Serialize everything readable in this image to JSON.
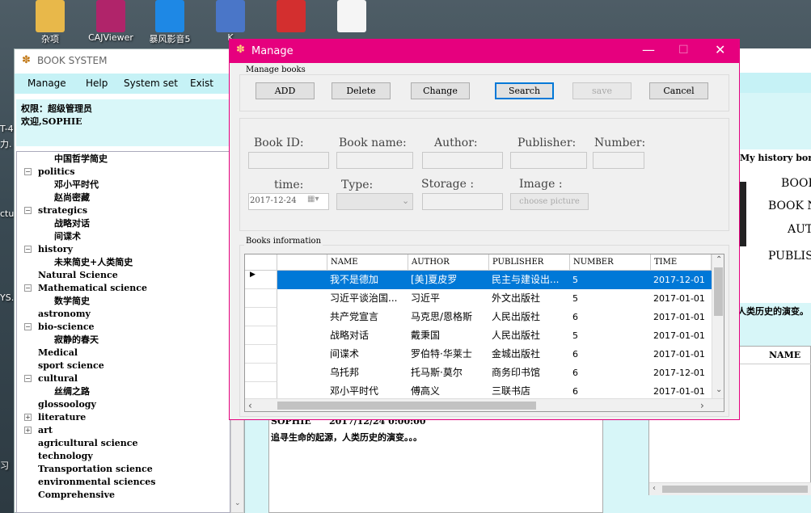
{
  "desktop": {
    "icons": [
      {
        "label": "杂项",
        "color": "#e8b84a"
      },
      {
        "label": "CAJViewer",
        "color": "#b0246a"
      },
      {
        "label": "暴风影音5",
        "color": "#1e88e5"
      },
      {
        "label": "K",
        "color": "#4a76c8"
      },
      {
        "label": "",
        "color": "#d32f2f"
      },
      {
        "label": "",
        "color": "#f5f5f5"
      }
    ],
    "side_texts": [
      "T-4",
      "力.",
      "cture",
      "YS...",
      "习"
    ]
  },
  "book_system": {
    "title": "BOOK SYSTEM",
    "menu": [
      "Manage",
      "Help",
      "System set",
      "Exist"
    ],
    "info_line1": "权限：超级管理员",
    "info_line2": "欢迎,SOPHIE",
    "tree": [
      {
        "label": "中国哲学简史",
        "level": 1
      },
      {
        "label": "politics",
        "level": 0,
        "toggle": "−"
      },
      {
        "label": "邓小平时代",
        "level": 1
      },
      {
        "label": "赵尚密藏",
        "level": 1
      },
      {
        "label": "strategics",
        "level": 0,
        "toggle": "−"
      },
      {
        "label": "战略对话",
        "level": 1
      },
      {
        "label": "间谍术",
        "level": 1
      },
      {
        "label": "history",
        "level": 0,
        "toggle": "−"
      },
      {
        "label": "未来简史+人类简史",
        "level": 1
      },
      {
        "label": "Natural Science",
        "level": 0
      },
      {
        "label": "Mathematical science",
        "level": 0,
        "toggle": "−"
      },
      {
        "label": "数学简史",
        "level": 1
      },
      {
        "label": "astronomy",
        "level": 0
      },
      {
        "label": "bio-science",
        "level": 0,
        "toggle": "−"
      },
      {
        "label": "寂静的春天",
        "level": 1
      },
      {
        "label": "Medical",
        "level": 0
      },
      {
        "label": "sport science",
        "level": 0
      },
      {
        "label": "cultural",
        "level": 0,
        "toggle": "−"
      },
      {
        "label": "丝绸之路",
        "level": 1
      },
      {
        "label": "glossoology",
        "level": 0
      },
      {
        "label": "literature",
        "level": 0,
        "toggle": "+"
      },
      {
        "label": "art",
        "level": 0,
        "toggle": "+"
      },
      {
        "label": "agricultural science",
        "level": 0
      },
      {
        "label": "technology",
        "level": 0
      },
      {
        "label": "Transportation science",
        "level": 0
      },
      {
        "label": "environmental sciences",
        "level": 0
      },
      {
        "label": "Comprehensive",
        "level": 0
      }
    ]
  },
  "background": {
    "history_title": "My history borr",
    "book_label": "BOOK",
    "book_name_label": "BOOK NA",
    "author_label": "AUTH",
    "publisher_label": "PUBLISH",
    "desc_snippet": "人类历史的演变。",
    "name_col": "NAME",
    "record_user": "SOPHIE",
    "record_time": "2017/12/24 0:00:00",
    "record_text": "追寻生命的起源，人类历史的演变。。。"
  },
  "dialog": {
    "title": "Manage",
    "controls": {
      "minimize": "—",
      "maximize": "☐",
      "close": "✕"
    },
    "manage_group": "Manage books",
    "buttons": {
      "add": "ADD",
      "delete": "Delete",
      "change": "Change",
      "search": "Search",
      "save": "save",
      "cancel": "Cancel"
    },
    "fields": {
      "book_id": "Book ID:",
      "book_name": "Book name:",
      "author": "Author:",
      "publisher": "Publisher:",
      "number": "Number:",
      "time": "time:",
      "type": "Type:",
      "storage": "Storage :",
      "image": "Image :"
    },
    "time_value": "2017-12-24",
    "choose_picture": "choose picture",
    "books_group": "Books information",
    "table": {
      "columns": [
        "NAME",
        "AUTHOR",
        "PUBLISHER",
        "NUMBER",
        "TIME"
      ],
      "rows": [
        [
          "我不是德加",
          "[美]夏皮罗",
          "民主与建设出...",
          "5",
          "2017-12-01"
        ],
        [
          "习近平谈治国...",
          "习近平",
          "外文出版社",
          "5",
          "2017-01-01"
        ],
        [
          "共产党宣言",
          "马克思/恩格斯",
          "人民出版社",
          "6",
          "2017-01-01"
        ],
        [
          "战略对话",
          "戴秉国",
          "人民出版社",
          "5",
          "2017-01-01"
        ],
        [
          "间谍术",
          "罗伯特·华莱士",
          "金城出版社",
          "6",
          "2017-01-01"
        ],
        [
          "乌托邦",
          "托马斯·莫尔",
          "商务印书馆",
          "6",
          "2017-12-01"
        ],
        [
          "邓小平时代",
          "傅高义",
          "三联书店",
          "6",
          "2017-01-01"
        ]
      ]
    }
  }
}
